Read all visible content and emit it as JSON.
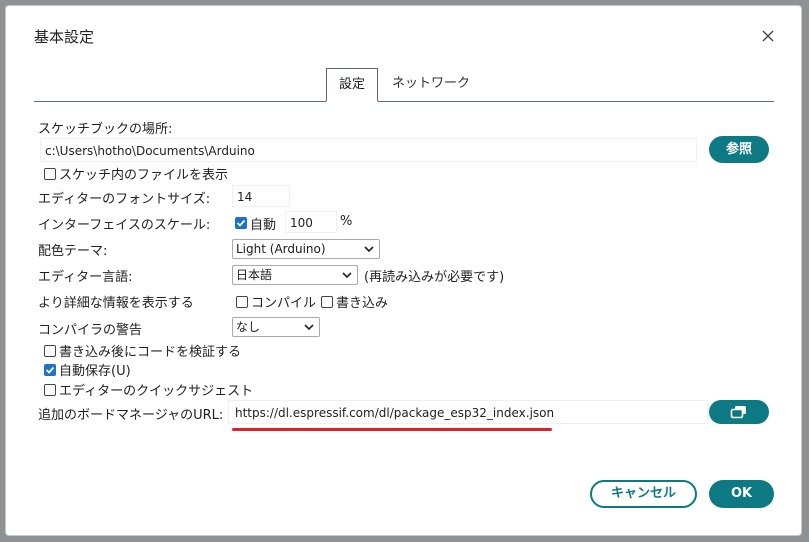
{
  "dialog": {
    "title": "基本設定",
    "close_icon": "close-icon"
  },
  "tabs": [
    {
      "label": "設定",
      "active": true
    },
    {
      "label": "ネットワーク",
      "active": false
    }
  ],
  "sketchbook": {
    "label": "スケッチブックの場所:",
    "path": "c:\\Users\\hotho\\Documents\\Arduino",
    "browse_label": "参照",
    "show_files_label": "スケッチ内のファイルを表示",
    "show_files_checked": false
  },
  "font_size": {
    "label": "エディターのフォントサイズ:",
    "value": "14"
  },
  "scale": {
    "label": "インターフェイスのスケール:",
    "auto_label": "自動",
    "auto_checked": true,
    "value": "100",
    "unit": "%"
  },
  "theme": {
    "label": "配色テーマ:",
    "selected": "Light (Arduino)"
  },
  "language": {
    "label": "エディター言語:",
    "selected": "日本語",
    "note": "(再読み込みが必要です)"
  },
  "verbose": {
    "label": "より詳細な情報を表示する",
    "compile_label": "コンパイル",
    "compile_checked": false,
    "upload_label": "書き込み",
    "upload_checked": false
  },
  "warnings": {
    "label": "コンパイラの警告",
    "selected": "なし"
  },
  "options": {
    "verify_label": "書き込み後にコードを検証する",
    "verify_checked": false,
    "autosave_label": "自動保存(U)",
    "autosave_checked": true,
    "quick_suggest_label": "エディターのクイックサジェスト",
    "quick_suggest_checked": false
  },
  "board_urls": {
    "label": "追加のボードマネージャのURL:",
    "value": "https://dl.espressif.com/dl/package_esp32_index.json",
    "edit_icon": "open-window-icon"
  },
  "footer": {
    "cancel_label": "キャンセル",
    "ok_label": "OK"
  },
  "colors": {
    "accent": "#0c7983",
    "checkbox_checked": "#1a73c8",
    "highlight_underline": "#e0212b"
  }
}
